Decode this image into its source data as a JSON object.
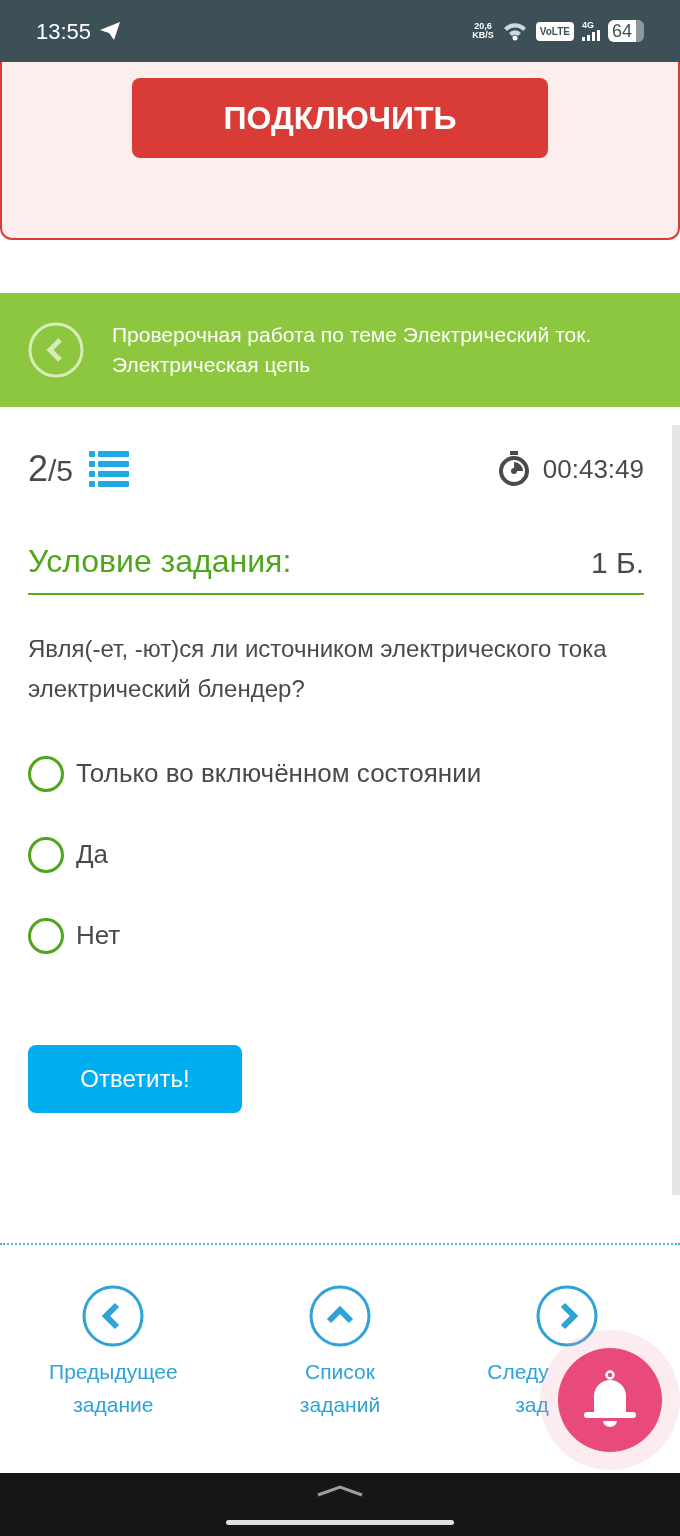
{
  "status_bar": {
    "time": "13:55",
    "speed": "20,6",
    "speed_unit": "KB/S",
    "volte": "VoLTE",
    "network": "4G",
    "battery": "64"
  },
  "promo": {
    "button": "ПОДКЛЮЧИТЬ"
  },
  "header": {
    "title": "Проверочная работа по теме Электрический ток. Электрическая цепь"
  },
  "progress": {
    "current": "2",
    "total": "/5",
    "timer": "00:43:49"
  },
  "task": {
    "heading": "Условие задания:",
    "points": "1 Б.",
    "question": "Явля(-ет, -ют)ся ли источником электрического тока электрический блендер?"
  },
  "options": [
    {
      "label": "Только во включённом состоянии",
      "selected": false
    },
    {
      "label": "Да",
      "selected": false
    },
    {
      "label": "Нет",
      "selected": false
    }
  ],
  "answer_button": "Ответить!",
  "nav": [
    {
      "kind": "prev",
      "lines": [
        "Предыдущее",
        "задание"
      ]
    },
    {
      "kind": "list",
      "lines": [
        "Список",
        "заданий"
      ]
    },
    {
      "kind": "next",
      "lines": [
        "Следу",
        "зад"
      ]
    }
  ]
}
